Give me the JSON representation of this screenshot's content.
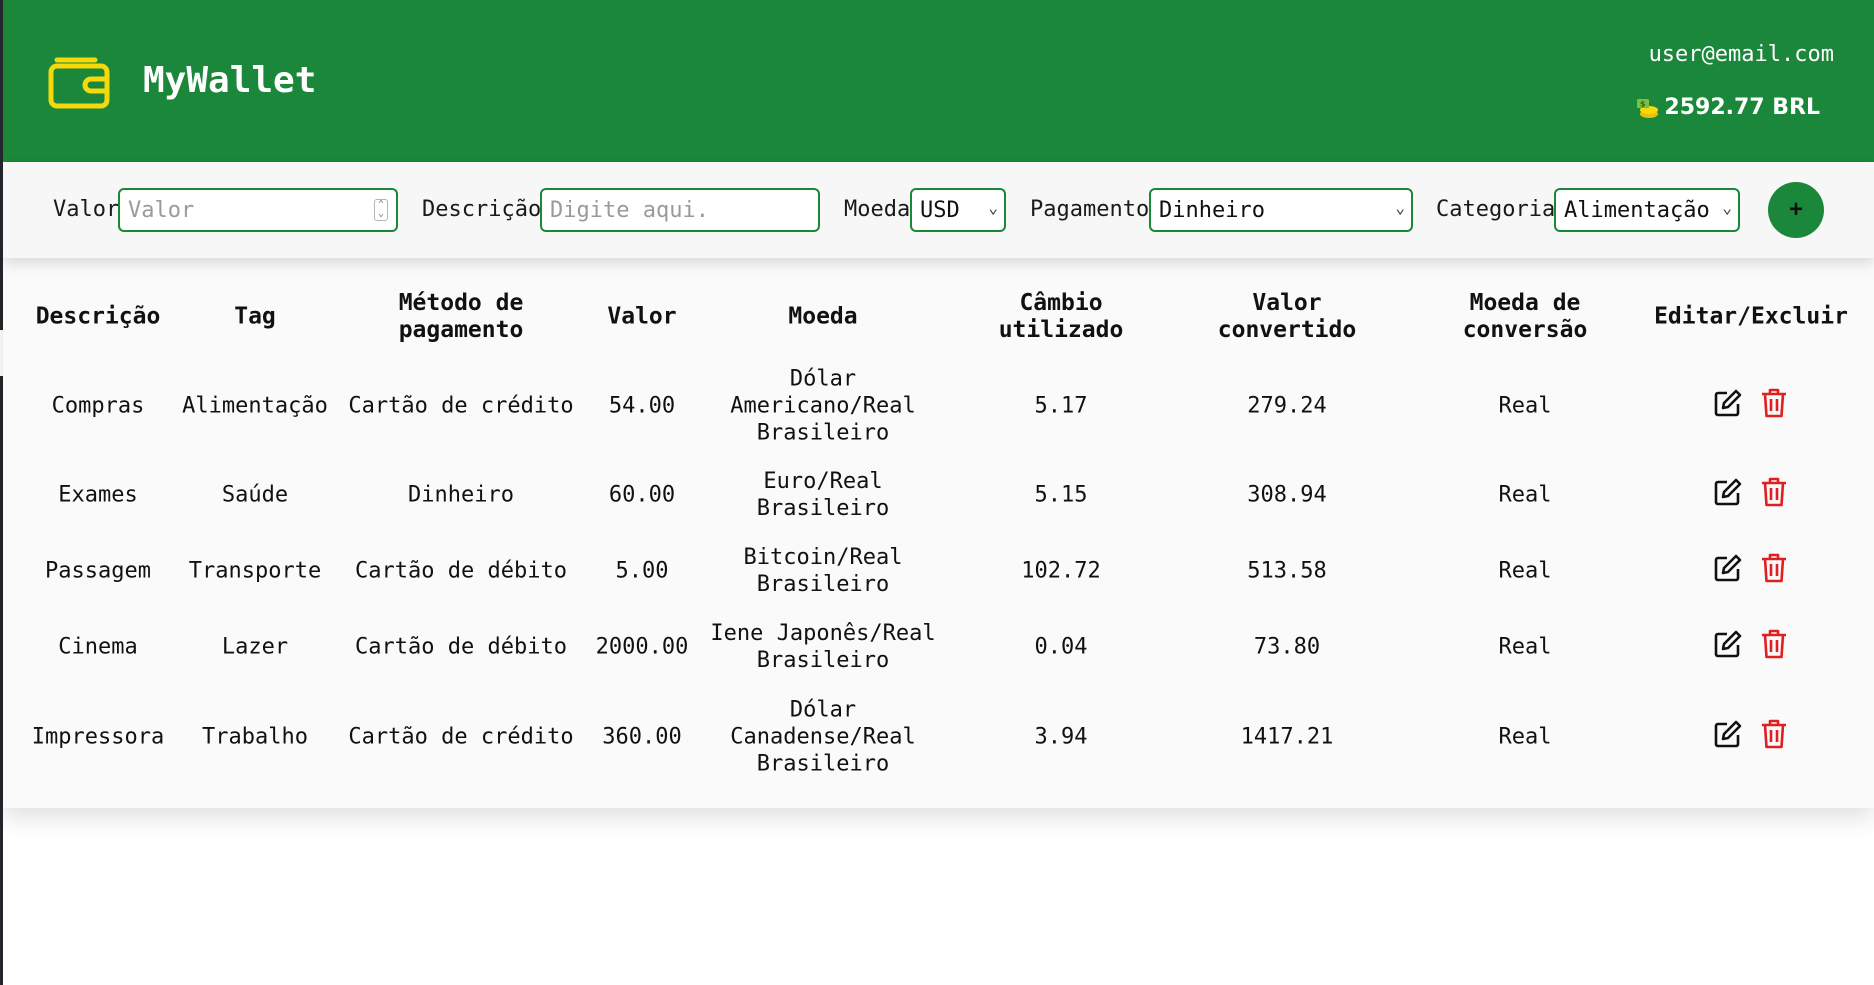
{
  "header": {
    "brand": "MyWallet",
    "email": "user@email.com",
    "balance": "2592.77 BRL",
    "colors": {
      "primary": "#1a873a",
      "logo": "#f5d90a",
      "delete": "#e02020"
    }
  },
  "form": {
    "valor_label": "Valor",
    "valor_placeholder": "Valor",
    "descricao_label": "Descrição",
    "descricao_placeholder": "Digite aqui.",
    "moeda_label": "Moeda",
    "moeda_value": "USD",
    "pagamento_label": "Pagamento",
    "pagamento_value": "Dinheiro",
    "categoria_label": "Categoria",
    "categoria_value": "Alimentação",
    "add_label": "+"
  },
  "table": {
    "headers": [
      "Descrição",
      "Tag",
      "Método de pagamento",
      "Valor",
      "Moeda",
      "Câmbio utilizado",
      "Valor convertido",
      "Moeda de conversão",
      "Editar/Excluir"
    ],
    "rows": [
      {
        "descricao": "Compras",
        "tag": "Alimentação",
        "metodo": "Cartão de crédito",
        "valor": "54.00",
        "moeda": "Dólar Americano/Real Brasileiro",
        "cambio": "5.17",
        "convertido": "279.24",
        "conversao": "Real"
      },
      {
        "descricao": "Exames",
        "tag": "Saúde",
        "metodo": "Dinheiro",
        "valor": "60.00",
        "moeda": "Euro/Real Brasileiro",
        "cambio": "5.15",
        "convertido": "308.94",
        "conversao": "Real"
      },
      {
        "descricao": "Passagem",
        "tag": "Transporte",
        "metodo": "Cartão de débito",
        "valor": "5.00",
        "moeda": "Bitcoin/Real Brasileiro",
        "cambio": "102.72",
        "convertido": "513.58",
        "conversao": "Real"
      },
      {
        "descricao": "Cinema",
        "tag": "Lazer",
        "metodo": "Cartão de débito",
        "valor": "2000.00",
        "moeda": "Iene Japonês/Real Brasileiro",
        "cambio": "0.04",
        "convertido": "73.80",
        "conversao": "Real"
      },
      {
        "descricao": "Impressora",
        "tag": "Trabalho",
        "metodo": "Cartão de crédito",
        "valor": "360.00",
        "moeda": "Dólar Canadense/Real Brasileiro",
        "cambio": "3.94",
        "convertido": "1417.21",
        "conversao": "Real"
      }
    ],
    "icons": {
      "edit": "edit-icon",
      "delete": "trash-icon"
    }
  }
}
